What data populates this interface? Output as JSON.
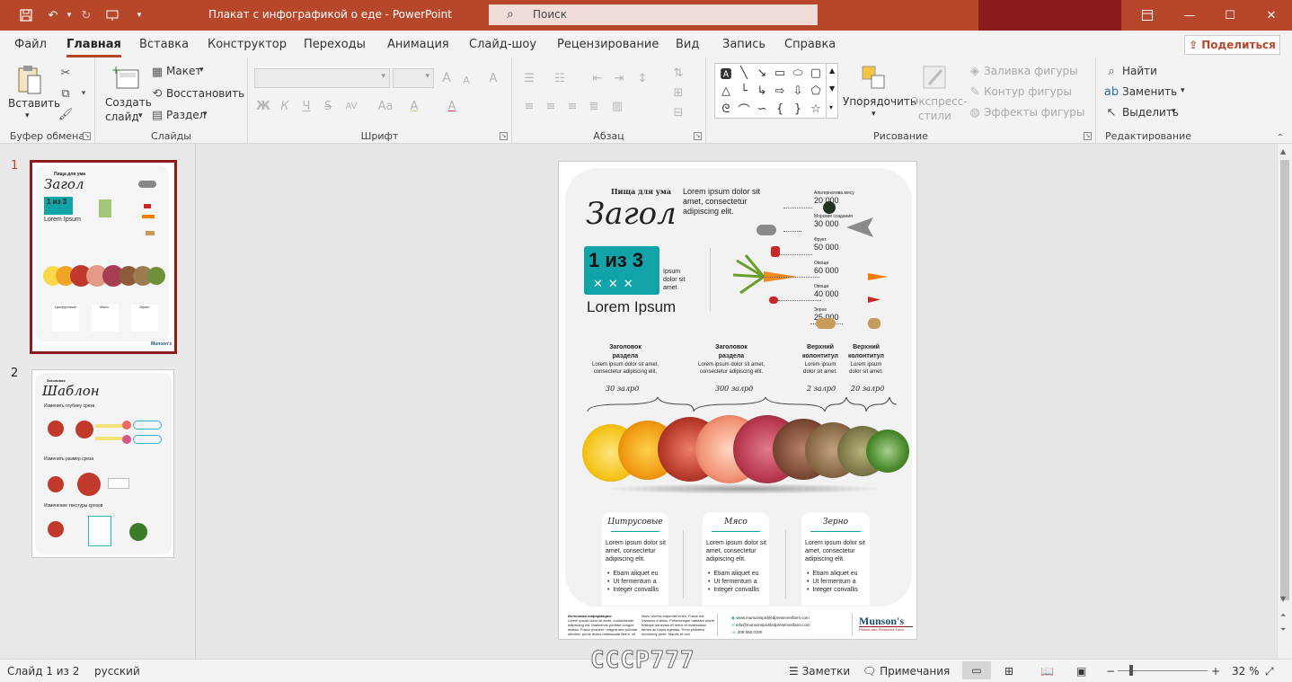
{
  "window": {
    "title": "Плакат с инфографикой о еде  -  PowerPoint",
    "search_placeholder": "Поиск"
  },
  "quick_access": {
    "save": "save-icon",
    "undo": "undo-icon",
    "redo": "redo-icon",
    "present": "present-icon",
    "customize": "customize-icon"
  },
  "tabs": [
    {
      "label": "Файл",
      "active": false
    },
    {
      "label": "Главная",
      "active": true
    },
    {
      "label": "Вставка",
      "active": false
    },
    {
      "label": "Конструктор",
      "active": false
    },
    {
      "label": "Переходы",
      "active": false
    },
    {
      "label": "Анимация",
      "active": false
    },
    {
      "label": "Слайд-шоу",
      "active": false
    },
    {
      "label": "Рецензирование",
      "active": false
    },
    {
      "label": "Вид",
      "active": false
    },
    {
      "label": "Запись",
      "active": false
    },
    {
      "label": "Справка",
      "active": false
    }
  ],
  "share_label": "Поделиться",
  "ribbon": {
    "clipboard": {
      "group": "Буфер обмена",
      "paste": "Вставить"
    },
    "slides": {
      "group": "Слайды",
      "new_slide_1": "Создать",
      "new_slide_2": "слайд",
      "layout": "Макет",
      "reset": "Восстановить",
      "section": "Раздел"
    },
    "font": {
      "group": "Шрифт",
      "bold": "Ж",
      "italic": "К",
      "underline": "Ч",
      "strike": "S",
      "spacing": "AV",
      "case": "Aa",
      "size_up": "A",
      "size_down": "A",
      "clear": "A",
      "highlight": "A",
      "color": "A"
    },
    "paragraph": {
      "group": "Абзац"
    },
    "drawing": {
      "group": "Рисование",
      "arrange_1": "Упорядочить",
      "quick_styles_1": "Экспресс-",
      "quick_styles_2": "стили",
      "fill": "Заливка фигуры",
      "outline": "Контур фигуры",
      "effects": "Эффекты фигуры"
    },
    "editing": {
      "group": "Редактирование",
      "find": "Найти",
      "replace": "Заменить",
      "select": "Выделить"
    }
  },
  "thumbnails": [
    {
      "number": "1",
      "title": "Загол",
      "subtitle": "Пища для ума",
      "badge": "1 из 3",
      "lorem": "Lorem Ipsum",
      "cols": [
        "Цитрусовые",
        "Мясо",
        "Зерно"
      ],
      "logo": "Munson's"
    },
    {
      "number": "2",
      "title": "Шаблон",
      "subtitle": "Заголовок",
      "lines": [
        "Изменить глубину среза",
        "Изменить размер среза",
        "Изменение текстуры срезов"
      ]
    }
  ],
  "slide": {
    "kicker": "Пища для ума",
    "title": "Загол",
    "intro": [
      "Lorem ipsum dolor sit",
      "amet, consectetur",
      "adipiscing elit."
    ],
    "badge_main": "1 из 3",
    "badge_side": [
      "Ipsum",
      "dolor sit",
      "amet"
    ],
    "lorem_title": "Lorem Ipsum",
    "stats": [
      {
        "label": "Альтернатива мясу",
        "value": "20 000"
      },
      {
        "label": "Морские создания",
        "value": "30 000"
      },
      {
        "label": "Фрукт",
        "value": "50 000"
      },
      {
        "label": "Овощи",
        "value": "60 000"
      },
      {
        "label": "Овощи",
        "value": "40 000"
      },
      {
        "label": "Зерно",
        "value": "25 000"
      }
    ],
    "sections": [
      {
        "title": [
          "Заголовок",
          "раздела"
        ],
        "text": [
          "Lorem ipsum dolor sit amet,",
          "consectetur adipiscing elit."
        ],
        "count": "30 залрд"
      },
      {
        "title": [
          "Заголовок",
          "раздела"
        ],
        "text": [
          "Lorem ipsum dolor sit amet,",
          "consectetur adipiscing elit."
        ],
        "count": "300 залрд"
      },
      {
        "title": [
          "Верхний",
          "колонтитул"
        ],
        "text": [
          "Lorem ipsum",
          "dolor sit amet."
        ],
        "count": "2 залрд"
      },
      {
        "title": [
          "Верхний",
          "колонтитул"
        ],
        "text": [
          "Lorem ipsum",
          "dolor sit amet."
        ],
        "count": "20 залрд"
      }
    ],
    "columns": [
      {
        "title": "Цитрусовые",
        "text": [
          "Lorem ipsum dolor sit",
          "amet, consectetur",
          "adipiscing elit."
        ],
        "bullets": [
          "Etiam aliquet eu",
          "Ut fermentum a",
          "Integer convallis"
        ]
      },
      {
        "title": "Мясо",
        "text": [
          "Lorem ipsum dolor sit",
          "amet, consectetur",
          "adipiscing elit."
        ],
        "bullets": [
          "Etiam aliquet eu",
          "Ut fermentum a",
          "Integer convallis"
        ]
      },
      {
        "title": "Зерно",
        "text": [
          "Lorem ipsum dolor sit",
          "amet, consectetur",
          "adipiscing elit."
        ],
        "bullets": [
          "Etiam aliquet eu",
          "Ut fermentum a",
          "Integer convallis"
        ]
      }
    ],
    "footer": {
      "sources_title": "Источники информации:",
      "sources": [
        "Lorem ipsum dolor sit amet, consectetuer",
        "adipiscing elit. Maecenas porttitor congue",
        "massa. Fusce posuere, magna sed pulvinar",
        "ultricies, purus lectus malesuada libero, sit"
      ],
      "note": [
        "Nunc viverra imperdiet enim. Fusce est.",
        "Vivamus a tellus. Pellentesque habitant morbi",
        "tristique senectus et netus et malesuada",
        "fames ac turpis egestas. Proin pharetra",
        "nonummy pede. Mauris et orci."
      ],
      "web": "www.munsonspickledpreservesfarm.com",
      "email": "info@munsonspickledpreservesfarm.com",
      "phone": "208 555 0100",
      "logo": "Munson's",
      "tagline": "Pickles and Preserves Farm"
    }
  },
  "status": {
    "slide": "Слайд 1 из 2",
    "language": "русский",
    "notes": "Заметки",
    "comments": "Примечания",
    "zoom": "32 %"
  },
  "watermark": "CCCP777",
  "colors": {
    "accent": "#b7472a",
    "teal": "#12a3a8",
    "selected_border": "#8c1c1c"
  }
}
